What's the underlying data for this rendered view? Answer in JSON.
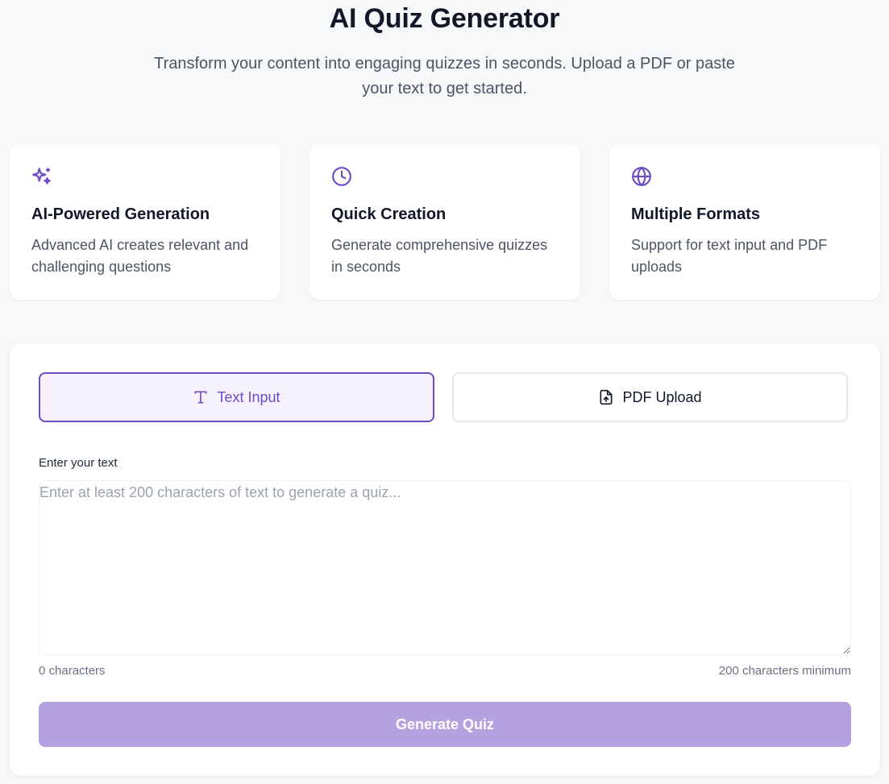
{
  "header": {
    "title": "AI Quiz Generator",
    "subtitle": "Transform your content into engaging quizzes in seconds. Upload a PDF or paste your text to get started."
  },
  "features": [
    {
      "icon": "sparkles-icon",
      "title": "AI-Powered Generation",
      "description": "Advanced AI creates relevant and challenging questions"
    },
    {
      "icon": "clock-icon",
      "title": "Quick Creation",
      "description": "Generate comprehensive quizzes in seconds"
    },
    {
      "icon": "globe-icon",
      "title": "Multiple Formats",
      "description": "Support for text input and PDF uploads"
    }
  ],
  "tabs": {
    "text_input": {
      "label": "Text Input",
      "icon": "text-icon",
      "active": true
    },
    "pdf_upload": {
      "label": "PDF Upload",
      "icon": "file-upload-icon",
      "active": false
    }
  },
  "form": {
    "label": "Enter your text",
    "placeholder": "Enter at least 200 characters of text to generate a quiz...",
    "value": "",
    "char_count": "0 characters",
    "char_minimum": "200 characters minimum"
  },
  "generate_button": {
    "label": "Generate Quiz",
    "disabled": true
  },
  "colors": {
    "accent": "#6d4cc4",
    "accent_light": "#f5f2fd",
    "button_disabled": "#b4a2e0",
    "background": "#f7f8fa"
  }
}
